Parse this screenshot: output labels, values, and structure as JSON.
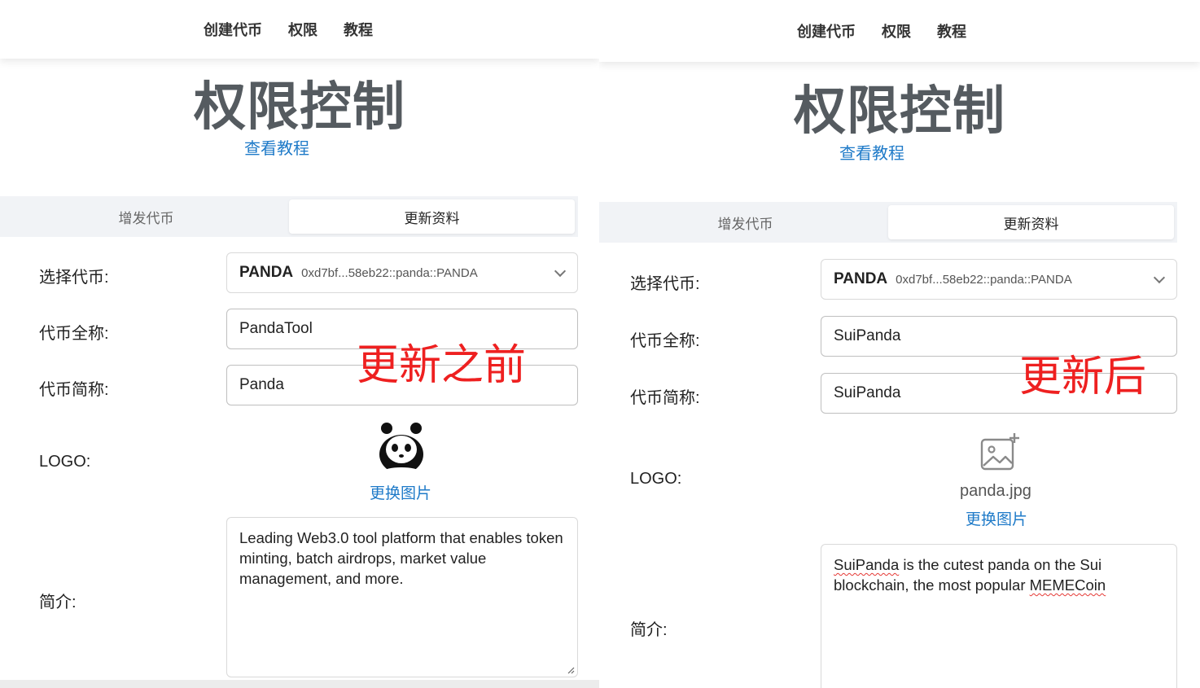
{
  "nav": {
    "items": [
      "创建代币",
      "权限",
      "教程"
    ]
  },
  "page": {
    "title": "权限控制",
    "tutorial_link": "查看教程"
  },
  "tabs": [
    "增发代币",
    "更新资料"
  ],
  "form_labels": {
    "select_token": "选择代币:",
    "full_name": "代币全称:",
    "short_name": "代币简称:",
    "logo": "LOGO:",
    "intro": "简介:"
  },
  "before": {
    "annotation": "更新之前",
    "token_symbol": "PANDA",
    "token_address": "0xd7bf...58eb22::panda::PANDA",
    "full_name": "PandaTool",
    "short_name": "Panda",
    "change_image": "更换图片",
    "intro": "Leading Web3.0 tool platform that enables token minting, batch airdrops, market value management, and more."
  },
  "after": {
    "annotation": "更新后",
    "token_symbol": "PANDA",
    "token_address": "0xd7bf...58eb22::panda::PANDA",
    "full_name": "SuiPanda",
    "short_name": "SuiPanda",
    "logo_filename": "panda.jpg",
    "change_image": "更换图片",
    "intro_parts": [
      "SuiPanda",
      " is the cutest panda on the Sui blockchain, the most popular ",
      "MEMECoin"
    ]
  },
  "colors": {
    "link": "#1e7ac8",
    "annotation": "#ee2020",
    "title": "#555b60"
  }
}
